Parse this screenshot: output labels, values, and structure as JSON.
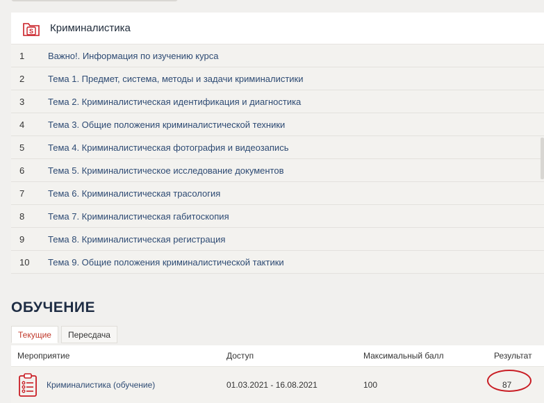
{
  "course": {
    "title": "Криминалистика",
    "topics": [
      {
        "num": "1",
        "label": "Важно!. Информация по изучению курса"
      },
      {
        "num": "2",
        "label": "Тема 1. Предмет, система, методы и задачи криминалистики"
      },
      {
        "num": "3",
        "label": "Тема 2. Криминалистическая идентификация и диагностика"
      },
      {
        "num": "4",
        "label": "Тема 3. Общие положения криминалистической техники"
      },
      {
        "num": "5",
        "label": "Тема 4. Криминалистическая фотография и видеозапись"
      },
      {
        "num": "6",
        "label": "Тема 5. Криминалистическое исследование документов"
      },
      {
        "num": "7",
        "label": "Тема 6. Криминалистическая трасология"
      },
      {
        "num": "8",
        "label": "Тема 7. Криминалистическая габитоскопия"
      },
      {
        "num": "9",
        "label": "Тема 8. Криминалистическая регистрация"
      },
      {
        "num": "10",
        "label": "Тема 9. Общие положения криминалистической тактики"
      }
    ]
  },
  "training": {
    "section_title": "ОБУЧЕНИЕ",
    "tabs": [
      {
        "label": "Текущие",
        "active": true
      },
      {
        "label": "Пересдача",
        "active": false
      }
    ],
    "columns": [
      "Мероприятие",
      "Доступ",
      "Максимальный балл",
      "Результат"
    ],
    "rows": [
      {
        "event": "Криминалистика (обучение)",
        "access": "01.03.2021 - 16.08.2021",
        "max_score": "100",
        "result": "87",
        "icon": "checklist-icon"
      }
    ]
  },
  "colors": {
    "accent": "#c91d24",
    "link": "#2d4a73",
    "title": "#1f2d44"
  }
}
